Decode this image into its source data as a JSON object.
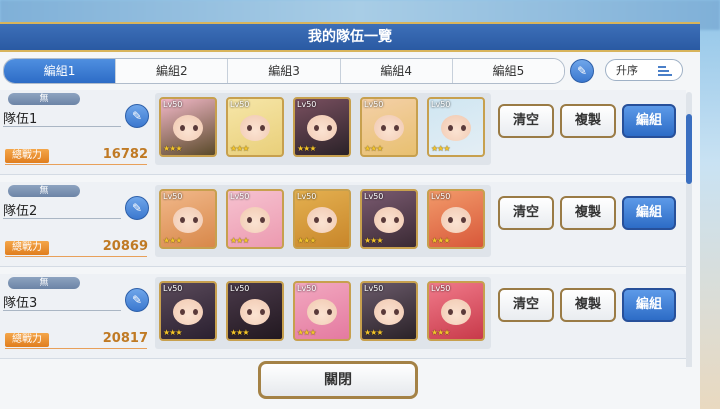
{
  "title": "我的隊伍一覽",
  "tabs": [
    "編組1",
    "編組2",
    "編組3",
    "編組4",
    "編組5"
  ],
  "sort_label": "升序",
  "parties": [
    {
      "attribute": "無",
      "name": "隊伍1",
      "power_label": "總戰力",
      "power": "16782",
      "units": [
        {
          "level": "Lv50",
          "stars": "★★★",
          "color": "#f2b8c8",
          "hair": "#5a4a2a"
        },
        {
          "level": "Lv50",
          "stars": "★★★",
          "color": "#f6e6a8",
          "hair": "#e9cf7a"
        },
        {
          "level": "Lv50",
          "stars": "★★★",
          "color": "#7a5060",
          "hair": "#2a2228"
        },
        {
          "level": "Lv50",
          "stars": "★★★",
          "color": "#f4d0a8",
          "hair": "#e8c070"
        },
        {
          "level": "Lv50",
          "stars": "★★★",
          "color": "#cfe6f2",
          "hair": "#e4eef4"
        }
      ]
    },
    {
      "attribute": "無",
      "name": "隊伍2",
      "power_label": "總戰力",
      "power": "20869",
      "units": [
        {
          "level": "Lv50",
          "stars": "★★★",
          "color": "#f1b88a",
          "hair": "#d8884a"
        },
        {
          "level": "Lv50",
          "stars": "★★★",
          "color": "#f6c2d0",
          "hair": "#ec9ab0"
        },
        {
          "level": "Lv50",
          "stars": "★★★",
          "color": "#e4b050",
          "hair": "#c8862a"
        },
        {
          "level": "Lv50",
          "stars": "★★★",
          "color": "#7a5a70",
          "hair": "#3a2a34"
        },
        {
          "level": "Lv50",
          "stars": "★★★",
          "color": "#f29a6a",
          "hair": "#d8583a"
        }
      ]
    },
    {
      "attribute": "無",
      "name": "隊伍3",
      "power_label": "總戰力",
      "power": "20817",
      "units": [
        {
          "level": "Lv50",
          "stars": "★★★",
          "color": "#5a4a5a",
          "hair": "#2a2030"
        },
        {
          "level": "Lv50",
          "stars": "★★★",
          "color": "#4a3a4a",
          "hair": "#221820"
        },
        {
          "level": "Lv50",
          "stars": "★★★",
          "color": "#f2a8c0",
          "hair": "#e47aa0"
        },
        {
          "level": "Lv50",
          "stars": "★★★",
          "color": "#6a5a6a",
          "hair": "#2a2228"
        },
        {
          "level": "Lv50",
          "stars": "★★★",
          "color": "#f07a8a",
          "hair": "#c83a4a"
        }
      ]
    }
  ],
  "buttons": {
    "clear": "清空",
    "copy": "複製",
    "edit": "編組"
  },
  "close_label": "關閉"
}
